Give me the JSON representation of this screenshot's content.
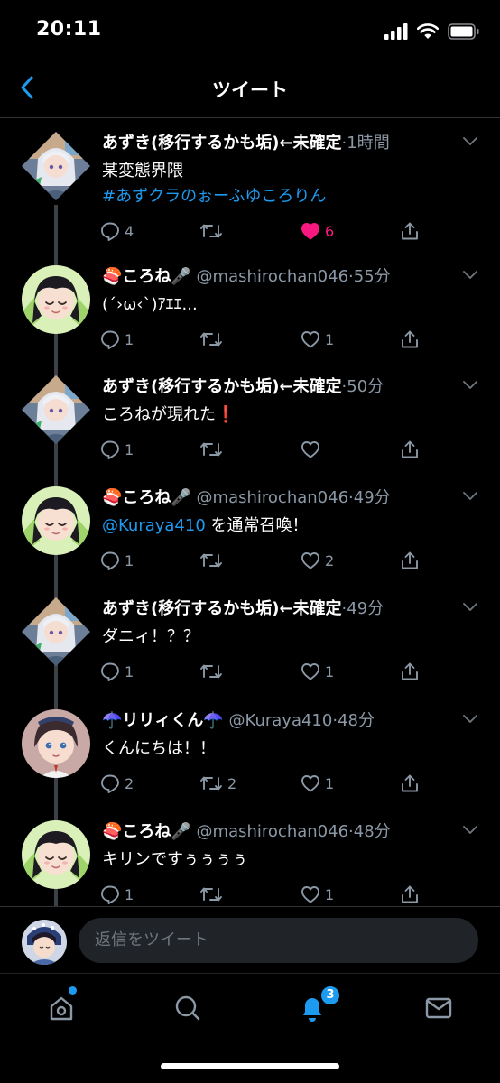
{
  "status_bar": {
    "time": "20:11"
  },
  "nav": {
    "title": "ツイート"
  },
  "thread": {
    "tweets": [
      {
        "name": "あずき(移行するかも垢)←未確定",
        "handle": "",
        "time": "·1時間",
        "text": "某変態界隈",
        "hashtag": "#あずクラのぉーふゆころりん",
        "mention": "",
        "text_after": "",
        "reply_count": "4",
        "retweet_count": "",
        "like_count": "6",
        "liked": true,
        "avatar": "diamond-girl"
      },
      {
        "name": "🍣ころね🎤",
        "handle": " @mashirochan046",
        "time": "·55分",
        "text": "(´›ω‹`)ｱｴｴ...",
        "hashtag": "",
        "mention": "",
        "text_after": "",
        "reply_count": "1",
        "retweet_count": "",
        "like_count": "1",
        "liked": false,
        "avatar": "round-black-hair"
      },
      {
        "name": "あずき(移行するかも垢)←未確定",
        "handle": "",
        "time": "·50分",
        "text": "ころねが現れた❗",
        "hashtag": "",
        "mention": "",
        "text_after": "",
        "reply_count": "1",
        "retweet_count": "",
        "like_count": "",
        "liked": false,
        "avatar": "diamond-girl"
      },
      {
        "name": "🍣ころね🎤",
        "handle": " @mashirochan046",
        "time": "·49分",
        "text": "",
        "hashtag": "",
        "mention": "@Kuraya410",
        "text_after": " を通常召喚！",
        "reply_count": "1",
        "retweet_count": "",
        "like_count": "2",
        "liked": false,
        "avatar": "round-black-hair"
      },
      {
        "name": "あずき(移行するかも垢)←未確定",
        "handle": "",
        "time": "·49分",
        "text": "ダニィ！？？",
        "hashtag": "",
        "mention": "",
        "text_after": "",
        "reply_count": "1",
        "retweet_count": "",
        "like_count": "1",
        "liked": false,
        "avatar": "diamond-girl"
      },
      {
        "name": "☂️リリィくん☂️",
        "handle": " @Kuraya410",
        "time": "·48分",
        "text": "くんにちは！！",
        "hashtag": "",
        "mention": "",
        "text_after": "",
        "reply_count": "2",
        "retweet_count": "2",
        "like_count": "1",
        "liked": false,
        "avatar": "round-brown-hair"
      },
      {
        "name": "🍣ころね🎤",
        "handle": " @mashirochan046",
        "time": "·48分",
        "text": "キリンですぅぅぅぅ",
        "hashtag": "",
        "mention": "",
        "text_after": "",
        "reply_count": "1",
        "retweet_count": "",
        "like_count": "1",
        "liked": false,
        "avatar": "round-black-hair"
      }
    ]
  },
  "reply_bar": {
    "placeholder": "返信をツイート"
  },
  "tabbar": {
    "tabs": [
      {
        "name": "home-icon",
        "active": false
      },
      {
        "name": "search-icon",
        "active": false
      },
      {
        "name": "notifications-icon",
        "active": true
      },
      {
        "name": "messages-icon",
        "active": false
      }
    ],
    "notification_badge": "3"
  },
  "colors": {
    "accent": "#1d9bf0",
    "like": "#f91880",
    "muted": "#8b98a5",
    "background": "#000000"
  }
}
